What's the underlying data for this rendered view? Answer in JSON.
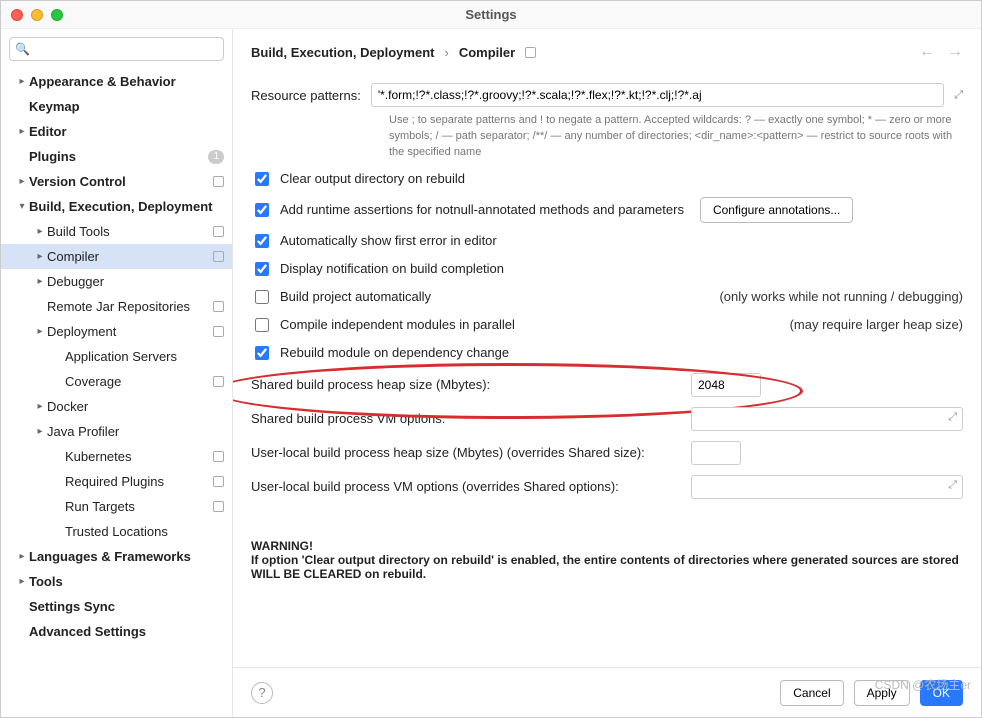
{
  "window": {
    "title": "Settings"
  },
  "search": {
    "placeholder": ""
  },
  "sidebar": [
    {
      "label": "Appearance & Behavior",
      "level": 0,
      "chev": ">",
      "bold": true
    },
    {
      "label": "Keymap",
      "level": 0,
      "chev": "",
      "bold": true
    },
    {
      "label": "Editor",
      "level": 0,
      "chev": ">",
      "bold": true
    },
    {
      "label": "Plugins",
      "level": 0,
      "chev": "",
      "bold": true,
      "badge": "1"
    },
    {
      "label": "Version Control",
      "level": 0,
      "chev": ">",
      "bold": true,
      "proj": true
    },
    {
      "label": "Build, Execution, Deployment",
      "level": 0,
      "chev": "v",
      "bold": true
    },
    {
      "label": "Build Tools",
      "level": 1,
      "chev": ">",
      "proj": true
    },
    {
      "label": "Compiler",
      "level": 1,
      "chev": ">",
      "proj": true,
      "selected": true
    },
    {
      "label": "Debugger",
      "level": 1,
      "chev": ">"
    },
    {
      "label": "Remote Jar Repositories",
      "level": 1,
      "chev": "",
      "proj": true
    },
    {
      "label": "Deployment",
      "level": 1,
      "chev": ">",
      "proj": true
    },
    {
      "label": "Application Servers",
      "level": 2,
      "chev": ""
    },
    {
      "label": "Coverage",
      "level": 2,
      "chev": "",
      "proj": true
    },
    {
      "label": "Docker",
      "level": 1,
      "chev": ">"
    },
    {
      "label": "Java Profiler",
      "level": 1,
      "chev": ">"
    },
    {
      "label": "Kubernetes",
      "level": 2,
      "chev": "",
      "proj": true
    },
    {
      "label": "Required Plugins",
      "level": 2,
      "chev": "",
      "proj": true
    },
    {
      "label": "Run Targets",
      "level": 2,
      "chev": "",
      "proj": true
    },
    {
      "label": "Trusted Locations",
      "level": 2,
      "chev": ""
    },
    {
      "label": "Languages & Frameworks",
      "level": 0,
      "chev": ">",
      "bold": true
    },
    {
      "label": "Tools",
      "level": 0,
      "chev": ">",
      "bold": true
    },
    {
      "label": "Settings Sync",
      "level": 0,
      "chev": "",
      "bold": true
    },
    {
      "label": "Advanced Settings",
      "level": 0,
      "chev": "",
      "bold": true
    }
  ],
  "breadcrumb": {
    "a": "Build, Execution, Deployment",
    "sep": "›",
    "b": "Compiler"
  },
  "resource": {
    "label": "Resource patterns:",
    "value": "'*.form;!?*.class;!?*.groovy;!?*.scala;!?*.flex;!?*.kt;!?*.clj;!?*.aj",
    "hint": "Use ; to separate patterns and ! to negate a pattern. Accepted wildcards: ? — exactly one symbol; * — zero or more symbols; / — path separator; /**/ — any number of directories; <dir_name>:<pattern> — restrict to source roots with the specified name"
  },
  "checks": {
    "clear": "Clear output directory on rebuild",
    "assertions": "Add runtime assertions for notnull-annotated methods and parameters",
    "configure_btn": "Configure annotations...",
    "autoshow": "Automatically show first error in editor",
    "notify": "Display notification on build completion",
    "auto_build": "Build project automatically",
    "auto_build_note": "(only works while not running / debugging)",
    "parallel": "Compile independent modules in parallel",
    "parallel_note": "(may require larger heap size)",
    "rebuild_dep": "Rebuild module on dependency change"
  },
  "fields": {
    "heap_label": "Shared build process heap size (Mbytes):",
    "heap_value": "2048",
    "vm_label": "Shared build process VM options:",
    "vm_value": "",
    "user_heap_label": "User-local build process heap size (Mbytes) (overrides Shared size):",
    "user_heap_value": "",
    "user_vm_label": "User-local build process VM options (overrides Shared options):",
    "user_vm_value": ""
  },
  "warning": {
    "h": "WARNING!",
    "body": "If option 'Clear output directory on rebuild' is enabled, the entire contents of directories where generated sources are stored WILL BE CLEARED on rebuild."
  },
  "footer": {
    "cancel": "Cancel",
    "apply": "Apply",
    "ok": "OK"
  },
  "watermark": "CSDN @农场主er"
}
